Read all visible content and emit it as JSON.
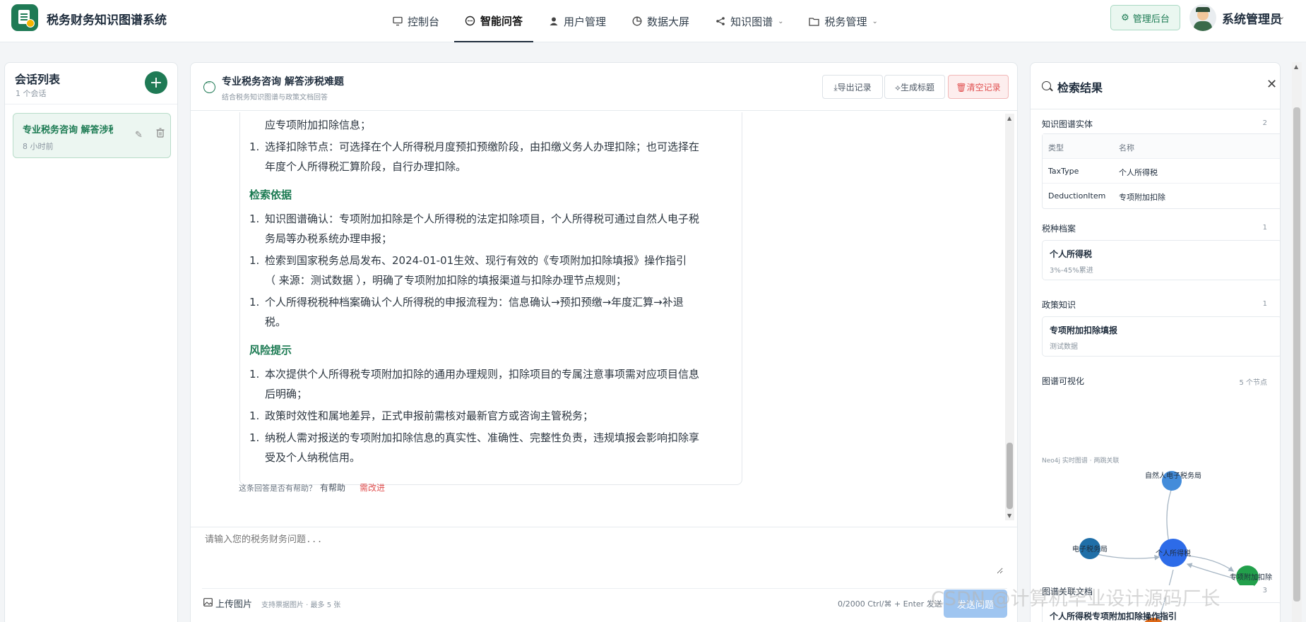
{
  "app": {
    "title": "税务财务知识图谱系统"
  },
  "nav": [
    {
      "label": "控制台",
      "icon": "monitor-icon",
      "active": false,
      "dropdown": false
    },
    {
      "label": "智能问答",
      "icon": "chat-icon",
      "active": true,
      "dropdown": false
    },
    {
      "label": "用户管理",
      "icon": "user-icon",
      "active": false,
      "dropdown": false
    },
    {
      "label": "数据大屏",
      "icon": "pie-icon",
      "active": false,
      "dropdown": false
    },
    {
      "label": "知识图谱",
      "icon": "share-icon",
      "active": false,
      "dropdown": true
    },
    {
      "label": "税务管理",
      "icon": "folder-icon",
      "active": false,
      "dropdown": true
    }
  ],
  "header": {
    "admin_button": "管理后台",
    "user_name": "系统管理员"
  },
  "sessions": {
    "title": "会话列表",
    "count": "1 个会话",
    "items": [
      {
        "title": "专业税务咨询 解答涉税难题",
        "time": "8 小时前"
      }
    ]
  },
  "chat": {
    "title": "专业税务咨询 解答涉税难题",
    "subtitle": "结合税务知识图谱与政策文档回答",
    "export_button": "⤓导出记录",
    "generate_button": "⟡生成标题",
    "clear_button": "🗑清空记录",
    "answer": {
      "intro_tail": "应专项附加扣除信息；",
      "steps": [
        {
          "num": "1.",
          "lines": [
            "选择扣除节点：可选择在个人所得税月度预扣预缴阶段，由扣缴义务人办理扣除；也可选择在",
            "年度个人所得税汇算阶段，自行办理扣除。"
          ]
        }
      ],
      "basis_heading": "检索依据",
      "basis": [
        {
          "num": "1.",
          "lines": [
            "知识图谱确认：专项附加扣除是个人所得税的法定扣除项目，个人所得税可通过自然人电子税",
            "务局等办税系统办理申报；"
          ]
        },
        {
          "num": "1.",
          "lines": [
            "检索到国家税务总局发布、2024-01-01生效、现行有效的《专项附加扣除填报》操作指引",
            "（ 来源：测试数据 ），明确了专项附加扣除的填报渠道与扣除办理节点规则；"
          ]
        },
        {
          "num": "1.",
          "lines": [
            "个人所得税税种档案确认个人所得税的申报流程为：信息确认→预扣预缴→年度汇算→补退",
            "税。"
          ]
        }
      ],
      "risk_heading": "风险提示",
      "risks": [
        {
          "num": "1.",
          "lines": [
            "本次提供个人所得税专项附加扣除的通用办理规则，扣除项目的专属注意事项需对应项目信息",
            "后明确；"
          ]
        },
        {
          "num": "1.",
          "lines": [
            "政策时效性和属地差异，正式申报前需核对最新官方或咨询主管税务；"
          ]
        },
        {
          "num": "1.",
          "lines": [
            "纳税人需对报送的专项附加扣除信息的真实性、准确性、完整性负责，违规填报会影响扣除享",
            "受及个人纳税信用。"
          ]
        }
      ]
    },
    "feedback": {
      "question": "这条回答是否有帮助？",
      "good": "有帮助",
      "bad": "需改进"
    },
    "composer": {
      "placeholder": "请输入您的税务财务问题...",
      "upload": "上传图片",
      "upload_hint": "支持票据图片 · 最多 5 张",
      "counter": "0/2000  Ctrl/⌘ + Enter 发送",
      "send": "发送问题"
    }
  },
  "results": {
    "title": "检索结果",
    "entities": {
      "label": "知识图谱实体",
      "count": "2",
      "headers": [
        "类型",
        "名称"
      ],
      "rows": [
        [
          "TaxType",
          "个人所得税"
        ],
        [
          "DeductionItem",
          "专项附加扣除"
        ]
      ]
    },
    "tax_profiles": {
      "label": "税种档案",
      "count": "1",
      "items": [
        {
          "title": "个人所得税",
          "sub": "3%-45%累进"
        }
      ]
    },
    "policies": {
      "label": "政策知识",
      "count": "1",
      "items": [
        {
          "title": "专项附加扣除填报",
          "sub": "测试数据"
        }
      ]
    },
    "graph": {
      "label": "图谱可视化",
      "count": "5 个节点",
      "sub": "Neo4j 实时图谱 · 两跳关联",
      "nodes": [
        {
          "label": "自然人电子税务局",
          "color": "#2f7fd6"
        },
        {
          "label": "电子税务局",
          "color": "#1f6fa8"
        },
        {
          "label": "个人所得税",
          "color": "#2d6be8"
        },
        {
          "label": "专项附加扣除",
          "color": "#22a04b"
        },
        {
          "label": "",
          "color": "#e06a18"
        }
      ]
    },
    "docs": {
      "label": "图谱关联文档",
      "count": "3",
      "first": "个人所得税专项附加扣除操作指引"
    }
  },
  "watermark": "CSDN @计算机毕业设计源码厂长"
}
